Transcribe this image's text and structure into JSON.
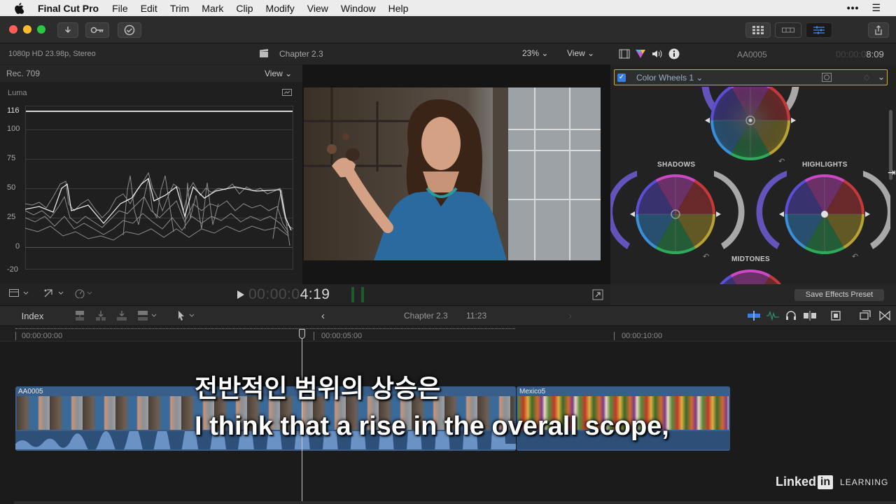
{
  "menubar": {
    "items": [
      "Final Cut Pro",
      "File",
      "Edit",
      "Trim",
      "Mark",
      "Clip",
      "Modify",
      "View",
      "Window",
      "Help"
    ]
  },
  "header": {
    "format": "1080p HD 23.98p, Stereo",
    "project_name": "Chapter 2.3",
    "zoom": "23%",
    "view_label": "View"
  },
  "scope": {
    "color_space": "Rec. 709",
    "view_label": "View",
    "mode": "Luma",
    "ticks": [
      "116",
      "100",
      "75",
      "50",
      "25",
      "0",
      "-20"
    ]
  },
  "viewer": {
    "timecode_dim": "00:00:0",
    "timecode_bright": "4:19"
  },
  "inspector": {
    "clip_name": "AA0005",
    "duration_dim": "00:00:0",
    "duration_bright": "8:09",
    "effect_name": "Color Wheels 1",
    "shadows_label": "SHADOWS",
    "highlights_label": "HIGHLIGHTS",
    "midtones_label": "MIDTONES",
    "save_preset_label": "Save Effects Preset"
  },
  "timeline_bar": {
    "index_label": "Index",
    "project_name": "Chapter 2.3",
    "duration": "11:23"
  },
  "timeline": {
    "ruler": [
      "00:00:00:00",
      "00:00:05:00",
      "00:00:10:00"
    ],
    "clips": [
      {
        "name": "AA0005"
      },
      {
        "name": "Mexico5"
      }
    ]
  },
  "subtitles": {
    "korean": "전반적인 범위의 상승은",
    "english": "I think that a rise in the overall scope,"
  },
  "watermark": {
    "brand": "Linked",
    "in": "in",
    "suffix": "LEARNING"
  }
}
